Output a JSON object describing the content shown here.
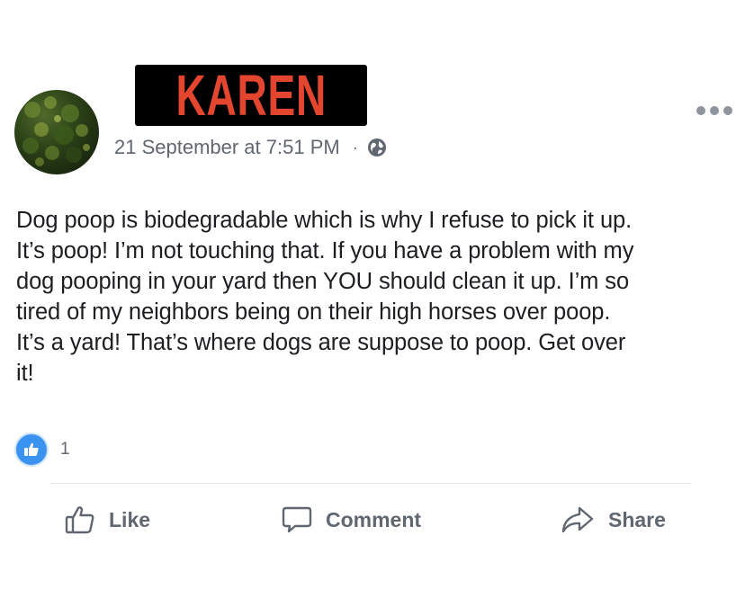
{
  "author": {
    "name": "KAREN",
    "name_color": "#e3452f",
    "name_bar_color": "#000000"
  },
  "post": {
    "timestamp": "21 September at 7:51 PM",
    "separator": "·",
    "privacy_icon": "globe-icon",
    "more_icon": "more-options-icon",
    "lines": [
      "Dog poop is biodegradable which is why I refuse to pick it up.",
      "It’s poop! I’m not touching that. If you have a problem with my",
      "dog pooping in your yard then YOU should clean it up. I’m so",
      "tired of my neighbors being on their high horses over poop.",
      "It’s a yard! That’s where dogs are suppose to poop. Get over",
      "it!"
    ]
  },
  "reactions": {
    "icon": "like-reaction-icon",
    "count": "1",
    "color": "#3b93f0"
  },
  "actions": {
    "like": {
      "label": "Like",
      "icon": "thumbs-up-icon"
    },
    "comment": {
      "label": "Comment",
      "icon": "speech-bubble-icon"
    },
    "share": {
      "label": "Share",
      "icon": "share-arrow-icon"
    }
  }
}
